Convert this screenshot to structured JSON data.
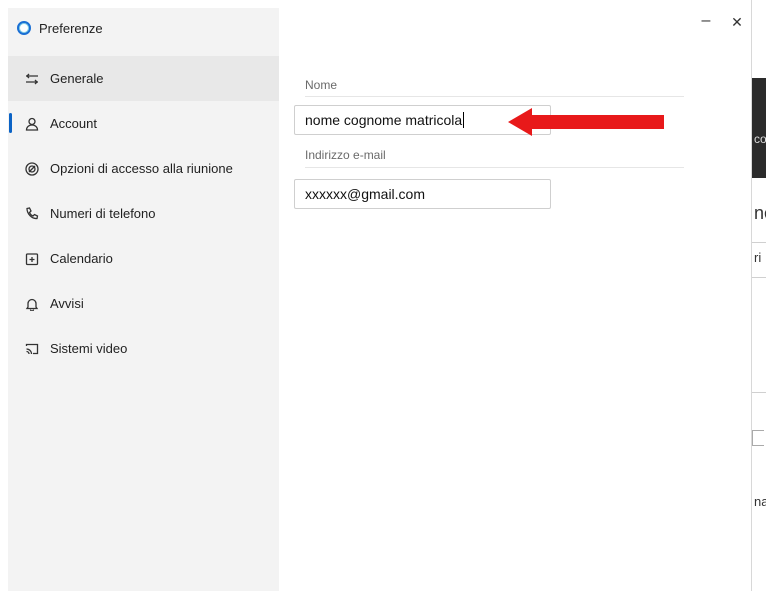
{
  "window": {
    "title": "Preferenze"
  },
  "controls": {
    "minimize": "–",
    "close": "✕"
  },
  "sidebar": {
    "items": [
      {
        "label": "Generale",
        "icon": "sliders-icon"
      },
      {
        "label": "Account",
        "icon": "user-icon"
      },
      {
        "label": "Opzioni di accesso alla riunione",
        "icon": "target-icon"
      },
      {
        "label": "Numeri di telefono",
        "icon": "phone-icon"
      },
      {
        "label": "Calendario",
        "icon": "calendar-icon"
      },
      {
        "label": "Avvisi",
        "icon": "bell-icon"
      },
      {
        "label": "Sistemi video",
        "icon": "cast-icon"
      }
    ]
  },
  "form": {
    "name_label": "Nome",
    "name_value": "nome cognome matricola",
    "email_label": "Indirizzo e-mail",
    "email_value": "xxxxxx@gmail.com"
  },
  "background_window": {
    "text_1": "co",
    "text_2": "ne",
    "text_3": "ri",
    "text_4": "na"
  },
  "colors": {
    "accent": "#0b63c5",
    "annotation_arrow": "#e8191a"
  }
}
